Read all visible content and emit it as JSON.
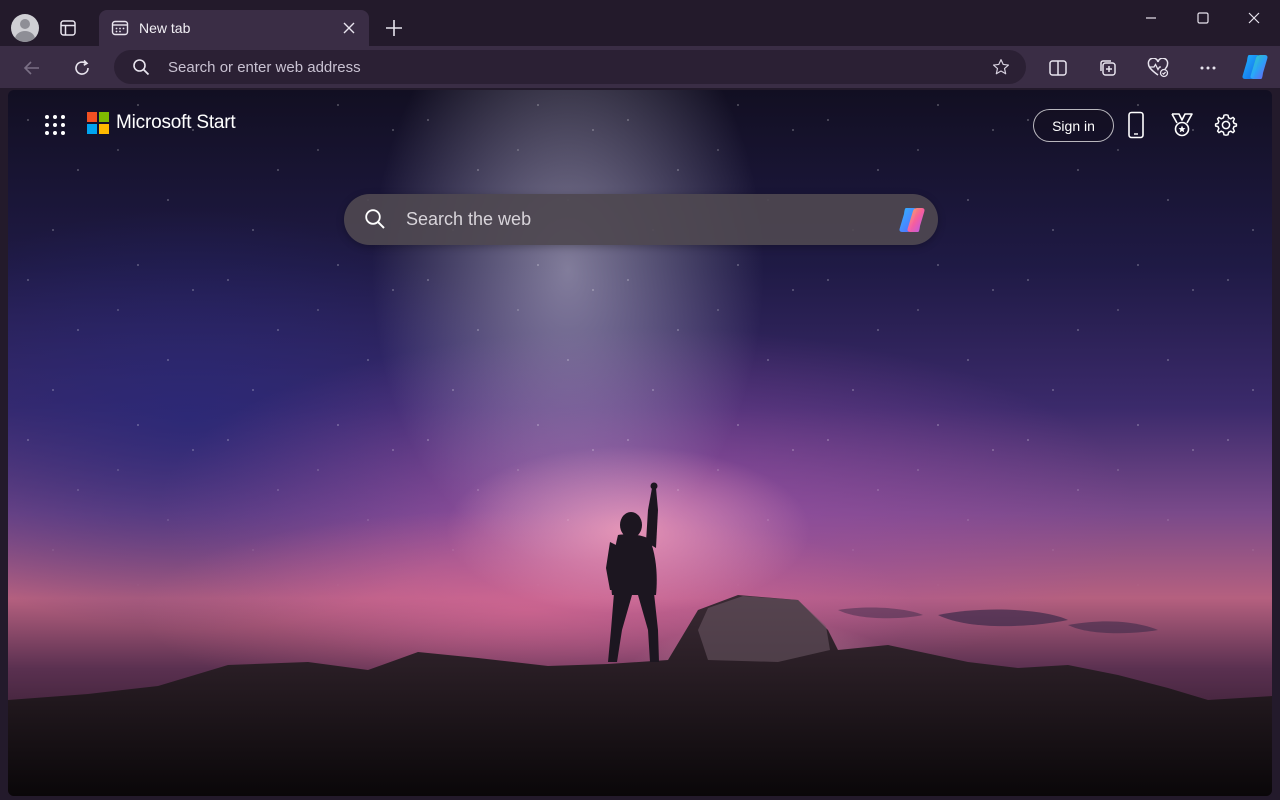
{
  "browser": {
    "tab": {
      "title": "New tab",
      "close_symbol": "✕"
    },
    "new_tab_symbol": "+",
    "address_bar": {
      "placeholder": "Search or enter web address",
      "value": ""
    }
  },
  "page": {
    "brand": {
      "name": "Microsoft Start",
      "logo_colors": [
        "#f25022",
        "#7fba00",
        "#00a4ef",
        "#ffb900"
      ]
    },
    "sign_in_label": "Sign in",
    "search": {
      "placeholder": "Search the web",
      "value": ""
    }
  },
  "icons": {
    "profile": "profile-avatar-icon",
    "tab_actions": "tab-actions-icon",
    "tab_favicon": "new-tab-page-icon",
    "back": "back-arrow-icon",
    "refresh": "refresh-icon",
    "address_search": "search-icon",
    "favorite": "star-icon",
    "split_screen": "split-screen-icon",
    "collections": "collections-icon",
    "browser_essentials": "heart-pulse-icon",
    "more": "more-dots-icon",
    "copilot": "copilot-icon",
    "apps": "app-launcher-icon",
    "phone": "phone-icon",
    "rewards": "rewards-medal-icon",
    "settings": "gear-icon"
  },
  "colors": {
    "titlebar": "#231a2b",
    "toolbar": "#3a2d45",
    "address_bar": "#2b2034"
  }
}
